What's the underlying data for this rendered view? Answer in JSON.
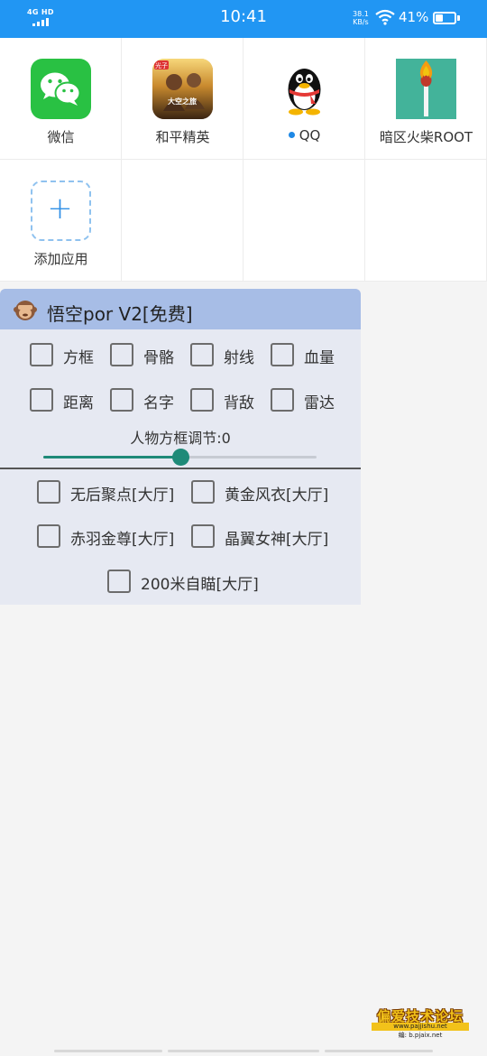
{
  "status_bar": {
    "network": "4G HD",
    "time": "10:41",
    "speed_value": "38.1",
    "speed_unit": "KB/s",
    "battery": "41%",
    "battery_level": 0.41,
    "wifi_icon": "wifi-icon"
  },
  "apps": [
    {
      "label": "微信",
      "icon": "wechat-icon"
    },
    {
      "label": "和平精英",
      "icon": "pubg-icon"
    },
    {
      "label": "QQ",
      "icon": "qq-penguin-icon",
      "has_dot": true
    },
    {
      "label": "暗区火柴ROOT",
      "icon": "match-icon"
    },
    {
      "label": "添加应用",
      "icon": "add-icon"
    }
  ],
  "pubg_icon_text": {
    "top": "光子",
    "bottom": "大空之旅"
  },
  "panel": {
    "title": "悟空por V2[免费]",
    "title_icon": "monkey-icon",
    "checkboxes_row1": [
      "方框",
      "骨骼",
      "射线",
      "血量"
    ],
    "checkboxes_row2": [
      "距离",
      "名字",
      "背敌",
      "雷达"
    ],
    "slider_label": "人物方框调节:0",
    "slider_value": 0.5,
    "checkboxes_row3": [
      "无后聚点[大厅]",
      "黄金风衣[大厅]"
    ],
    "checkboxes_row4": [
      "赤羽金尊[大厅]",
      "晶翼女神[大厅]"
    ],
    "checkboxes_row5": [
      "200米自瞄[大厅]"
    ]
  },
  "watermark": {
    "main": "偏爱技术论坛",
    "sub": "www.pajjishu.net",
    "sub2": "编: b.pjaix.net"
  },
  "colors": {
    "status_bar": "#2196f3",
    "panel_header": "#a7bde6",
    "panel_bg": "#e6e9f2",
    "slider_accent": "#1e8a78"
  }
}
